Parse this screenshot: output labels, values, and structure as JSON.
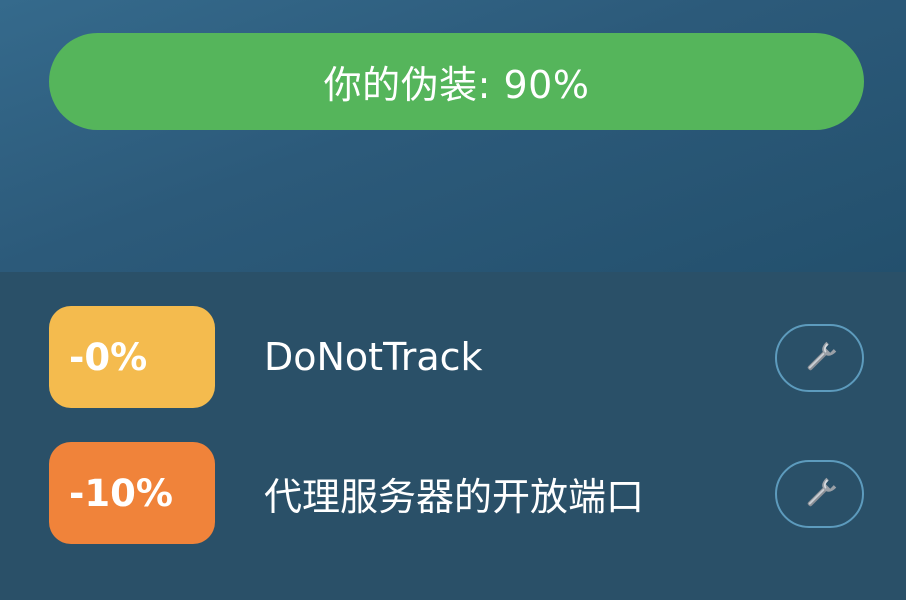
{
  "header": {
    "disguise_label": "你的伪装: 90%",
    "disguise_percent": 90,
    "bar_color": "#55b55b"
  },
  "checks": [
    {
      "penalty": "-0%",
      "name": "DoNotTrack",
      "badge_color": "#f4bb4e",
      "action_icon": "wrench-icon"
    },
    {
      "penalty": "-10%",
      "name": "代理服务器的开放端口",
      "badge_color": "#f0833a",
      "action_icon": "wrench-icon"
    }
  ]
}
